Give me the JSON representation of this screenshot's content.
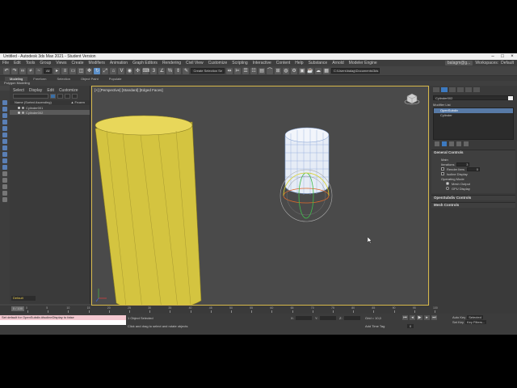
{
  "window": {
    "title": "Untitled - Autodesk 3ds Max 2021 - Student Version"
  },
  "menu": {
    "items": [
      "File",
      "Edit",
      "Tools",
      "Group",
      "Views",
      "Create",
      "Modifiers",
      "Animation",
      "Graph Editors",
      "Rendering",
      "Civil View",
      "Customize",
      "Scripting",
      "Interactive",
      "Content",
      "Help",
      "Substance",
      "Arnold",
      "Modeler Engine"
    ],
    "sign_in": "balagm@g...",
    "workspaces_label": "Workspaces:",
    "workspace_value": "Default"
  },
  "toolbar": {
    "filter_value": "All",
    "selection_set": "Create Selection Se",
    "project_path": "C:\\Users\\balag\\Documents\\3ds Max 2021"
  },
  "ribbon": {
    "tabs": [
      "Modeling",
      "Freeform",
      "Selection",
      "Object Paint",
      "Populate"
    ],
    "active_tab": "Modeling",
    "sub_label": "Polygon Modeling"
  },
  "scene_explorer": {
    "menu": [
      "Select",
      "Display",
      "Edit",
      "Customize"
    ],
    "header_left": "Name (Sorted Ascending)",
    "header_right": "▲ Frozen",
    "rows": [
      "Cylinder001",
      "Cylinder002"
    ],
    "layer_label": "Default"
  },
  "viewport": {
    "label": "[+] [Perspective] [Standard] [Edged Faces]"
  },
  "command_panel": {
    "object_name": "Cylinder002",
    "modifier_list_label": "Modifier List",
    "modifiers": [
      "OpenSubdiv",
      "Cylinder"
    ],
    "selected_modifier": "OpenSubdiv",
    "rollouts": {
      "general": {
        "title": "General Controls",
        "main_label": "Main",
        "iterations_label": "Iterations",
        "iterations_value": "3",
        "render_iters_label": "Render Iters",
        "render_iters_value": "0",
        "isoline_label": "Isoline Display",
        "operating_mode_label": "Operating Mode",
        "mesh_output_label": "Mesh Output",
        "gpu_display_label": "GPU Display"
      },
      "opensubdiv_title": "OpenSubdiv Controls",
      "mesh_title": "Mesh Controls"
    }
  },
  "timeline": {
    "slider_text": "0 / 100",
    "tick_labels": [
      "0",
      "5",
      "10",
      "15",
      "20",
      "25",
      "30",
      "35",
      "40",
      "45",
      "50",
      "55",
      "60",
      "65",
      "70",
      "75",
      "80",
      "85",
      "90",
      "95",
      "100"
    ]
  },
  "status": {
    "script_input": "Set default for OpenSubdiv.#IsolineDisplay to false",
    "objects_selected": "1 Object Selected",
    "prompt": "Click and drag to select and rotate objects",
    "x_label": "X:",
    "y_label": "Y:",
    "z_label": "Z:",
    "grid_label": "Grid = 10,0",
    "add_time_tag": "Add Time Tag",
    "frame_value": "0",
    "auto_key": "Auto Key",
    "set_key": "Set Key",
    "selected_value": "Selected",
    "key_filters": "Key Filters..."
  }
}
